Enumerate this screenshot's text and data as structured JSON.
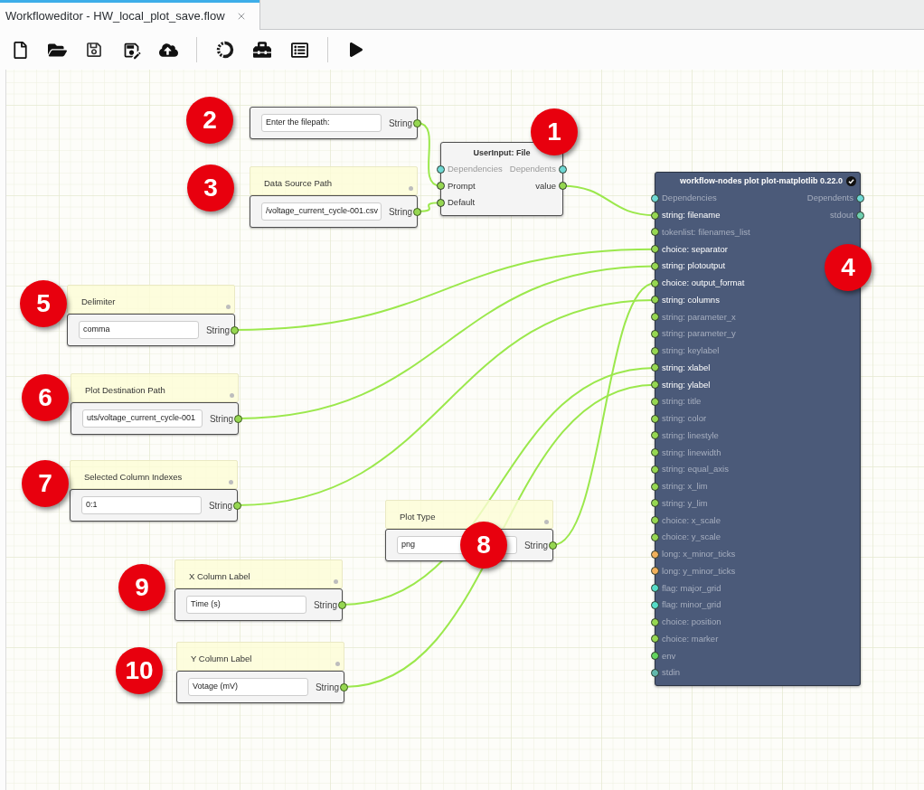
{
  "tab": {
    "title": "Workfloweditor - HW_local_plot_save.flow",
    "selected": true
  },
  "nodes": [
    {
      "kind": "string-input",
      "marker": "2",
      "value": "Enter the filepath:",
      "port": "String"
    },
    {
      "kind": "string-input",
      "marker": "3",
      "note": "Data Source Path",
      "value": "/voltage_current_cycle-001.csv",
      "port": "String"
    },
    {
      "kind": "user-input",
      "marker": "1",
      "title": "UserInput: File",
      "inputs": [
        {
          "label": "Dependencies",
          "color": "#6fd9d5",
          "connected": false
        },
        {
          "label": "Prompt",
          "color": "#96d751",
          "connected": true
        },
        {
          "label": "Default",
          "color": "#96d751",
          "connected": true
        }
      ],
      "outputs": [
        {
          "label": "Dependents",
          "color": "#6fd9d5",
          "connected": false
        },
        {
          "label": "value",
          "color": "#96d751",
          "connected": true
        }
      ]
    },
    {
      "kind": "tool",
      "marker": "4",
      "title": "workflow-nodes plot plot-matplotlib 0.22.0",
      "inputs": [
        {
          "label": "Dependencies",
          "color": "#6fd9d5",
          "connected": false
        },
        {
          "label": "string: filename",
          "color": "#96d751",
          "connected": true
        },
        {
          "label": "tokenlist: filenames_list",
          "color": "#96d751",
          "connected": false
        },
        {
          "label": "choice: separator",
          "color": "#96d751",
          "connected": true
        },
        {
          "label": "string: plotoutput",
          "color": "#96d751",
          "connected": true
        },
        {
          "label": "choice: output_format",
          "color": "#96d751",
          "connected": true
        },
        {
          "label": "string: columns",
          "color": "#96d751",
          "connected": true
        },
        {
          "label": "string: parameter_x",
          "color": "#96d751",
          "connected": false
        },
        {
          "label": "string: parameter_y",
          "color": "#96d751",
          "connected": false
        },
        {
          "label": "string: keylabel",
          "color": "#96d751",
          "connected": false
        },
        {
          "label": "string: xlabel",
          "color": "#96d751",
          "connected": true
        },
        {
          "label": "string: ylabel",
          "color": "#96d751",
          "connected": true
        },
        {
          "label": "string: title",
          "color": "#96d751",
          "connected": false
        },
        {
          "label": "string: color",
          "color": "#96d751",
          "connected": false
        },
        {
          "label": "string: linestyle",
          "color": "#96d751",
          "connected": false
        },
        {
          "label": "string: linewidth",
          "color": "#96d751",
          "connected": false
        },
        {
          "label": "string: equal_axis",
          "color": "#96d751",
          "connected": false
        },
        {
          "label": "string: x_lim",
          "color": "#96d751",
          "connected": false
        },
        {
          "label": "string: y_lim",
          "color": "#96d751",
          "connected": false
        },
        {
          "label": "choice: x_scale",
          "color": "#96d751",
          "connected": false
        },
        {
          "label": "choice: y_scale",
          "color": "#96d751",
          "connected": false
        },
        {
          "label": "long: x_minor_ticks",
          "color": "#f2b15c",
          "connected": false
        },
        {
          "label": "long: y_minor_ticks",
          "color": "#f2b15c",
          "connected": false
        },
        {
          "label": "flag: major_grid",
          "color": "#55dcc9",
          "connected": false
        },
        {
          "label": "flag: minor_grid",
          "color": "#55dcc9",
          "connected": false
        },
        {
          "label": "choice: position",
          "color": "#96d751",
          "connected": false
        },
        {
          "label": "choice: marker",
          "color": "#96d751",
          "connected": false
        },
        {
          "label": "env",
          "color": "#63d45e",
          "connected": false
        },
        {
          "label": "stdin",
          "color": "#62b8ac",
          "connected": false
        }
      ],
      "outputs": [
        {
          "label": "Dependents",
          "color": "#6fd9d5",
          "connected": false
        },
        {
          "label": "stdout",
          "color": "#6fd0b0",
          "connected": false
        }
      ]
    },
    {
      "kind": "string-input",
      "marker": "5",
      "note": "Delimiter",
      "value": "comma",
      "port": "String"
    },
    {
      "kind": "string-input",
      "marker": "6",
      "note": "Plot Destination Path",
      "value": "uts/voltage_current_cycle-001",
      "port": "String"
    },
    {
      "kind": "string-input",
      "marker": "7",
      "note": "Selected Column Indexes",
      "value": "0:1",
      "port": "String"
    },
    {
      "kind": "string-input",
      "marker": "8",
      "note": "Plot Type",
      "value": "png",
      "port": "String"
    },
    {
      "kind": "string-input",
      "marker": "9",
      "note": "X Column Label",
      "value": "Time (s)",
      "port": "String"
    },
    {
      "kind": "string-input",
      "marker": "10",
      "note": "Y Column Label",
      "value": "Votage (mV)",
      "port": "String"
    }
  ]
}
